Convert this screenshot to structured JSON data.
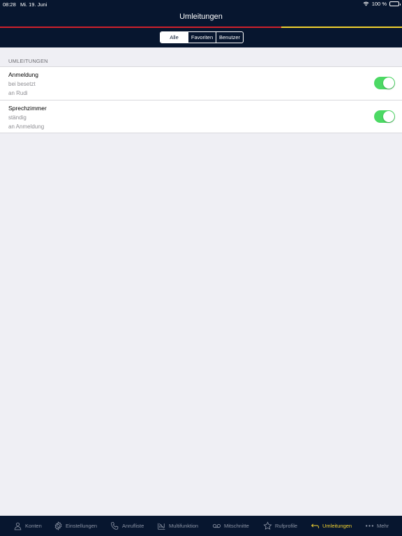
{
  "statusbar": {
    "time": "08:28",
    "date": "Mi. 19. Juni",
    "battery": "100 %"
  },
  "nav": {
    "title": "Umleitungen"
  },
  "colors": {
    "header_bg": "#07162f",
    "flag_red": "#d0212c",
    "flag_yellow": "#f2d230",
    "toggle_on": "#4cd964",
    "tab_active": "#f2d230",
    "tab_inactive": "#8b93a4"
  },
  "segments": {
    "all": "Alle",
    "favorites": "Favoriten",
    "users": "Benutzer",
    "selected": "Alle"
  },
  "section": {
    "header": "UMLEITUNGEN"
  },
  "rows": [
    {
      "title": "Anmeldung",
      "condition": "bei besetzt",
      "target": "an Rudi",
      "enabled": true
    },
    {
      "title": "Sprechzimmer",
      "condition": "ständig",
      "target": "an Anmeldung",
      "enabled": true
    }
  ],
  "tabs": [
    {
      "label": "Konten",
      "icon": "person-icon"
    },
    {
      "label": "Einstellungen",
      "icon": "gear-icon"
    },
    {
      "label": "Anrufliste",
      "icon": "phone-icon"
    },
    {
      "label": "Multifunktion",
      "icon": "multifunction-icon"
    },
    {
      "label": "Mitschnitte",
      "icon": "voicemail-icon"
    },
    {
      "label": "Rufprofile",
      "icon": "star-icon"
    },
    {
      "label": "Umleitungen",
      "icon": "forward-arrow-icon",
      "active": true
    },
    {
      "label": "Mehr",
      "icon": "more-dots-icon"
    }
  ]
}
